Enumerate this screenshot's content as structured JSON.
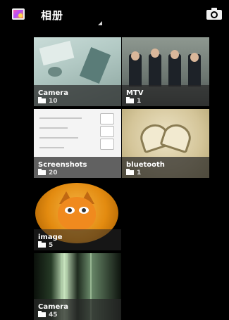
{
  "header": {
    "title": "相册",
    "app_icon": "gallery-app-icon",
    "dropdown_icon": "dropdown-triangle-icon",
    "camera_icon": "camera-icon"
  },
  "albums": [
    {
      "name": "Camera",
      "count": "10"
    },
    {
      "name": "MTV",
      "count": "1"
    },
    {
      "name": "Screenshots",
      "count": "20"
    },
    {
      "name": "bluetooth",
      "count": "1"
    },
    {
      "name": "image",
      "count": "5"
    },
    {
      "name": "Camera",
      "count": "45"
    }
  ],
  "colors": {
    "background": "#000000",
    "caption_overlay": "#282828",
    "text": "#ffffff"
  }
}
